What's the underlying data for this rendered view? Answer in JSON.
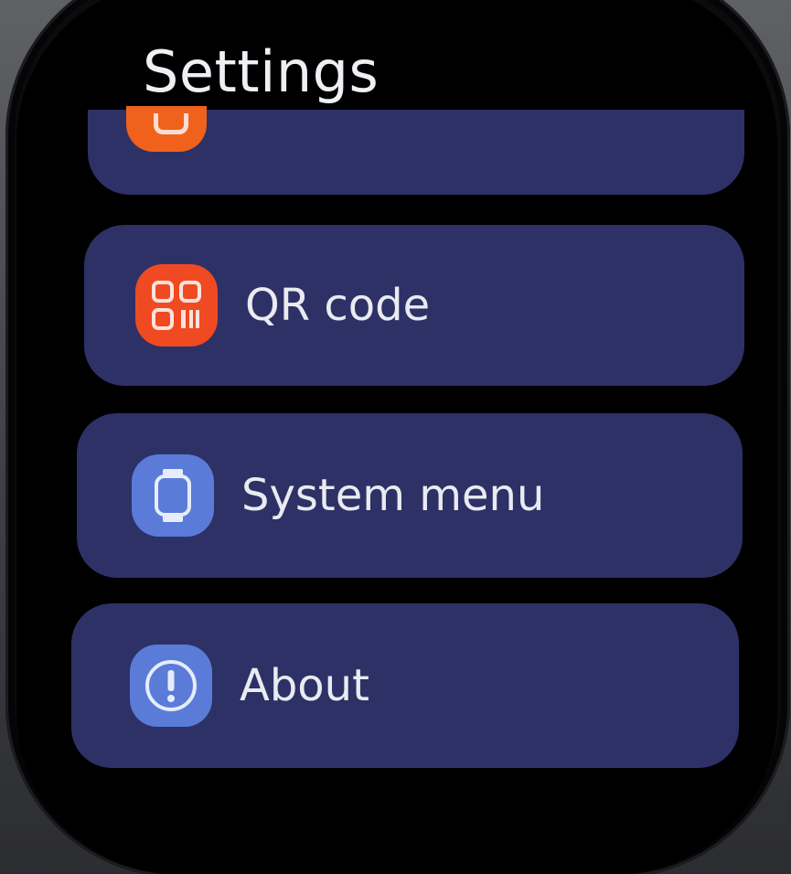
{
  "screen": {
    "title": "Settings"
  },
  "menu": {
    "items": [
      {
        "label": "QR code",
        "icon": "qr-code-icon",
        "icon_color": "#f04a22"
      },
      {
        "label": "System menu",
        "icon": "watch-icon",
        "icon_color": "#5a7bd8"
      },
      {
        "label": "About",
        "icon": "info-exclamation-icon",
        "icon_color": "#5a7bd8"
      }
    ],
    "partial_item_icon": "settings-item-icon",
    "partial_item_icon_color": "#f0621c"
  },
  "theme": {
    "card_color": "#2e3166",
    "background": "#000000",
    "text_color": "#e9ebf1"
  }
}
